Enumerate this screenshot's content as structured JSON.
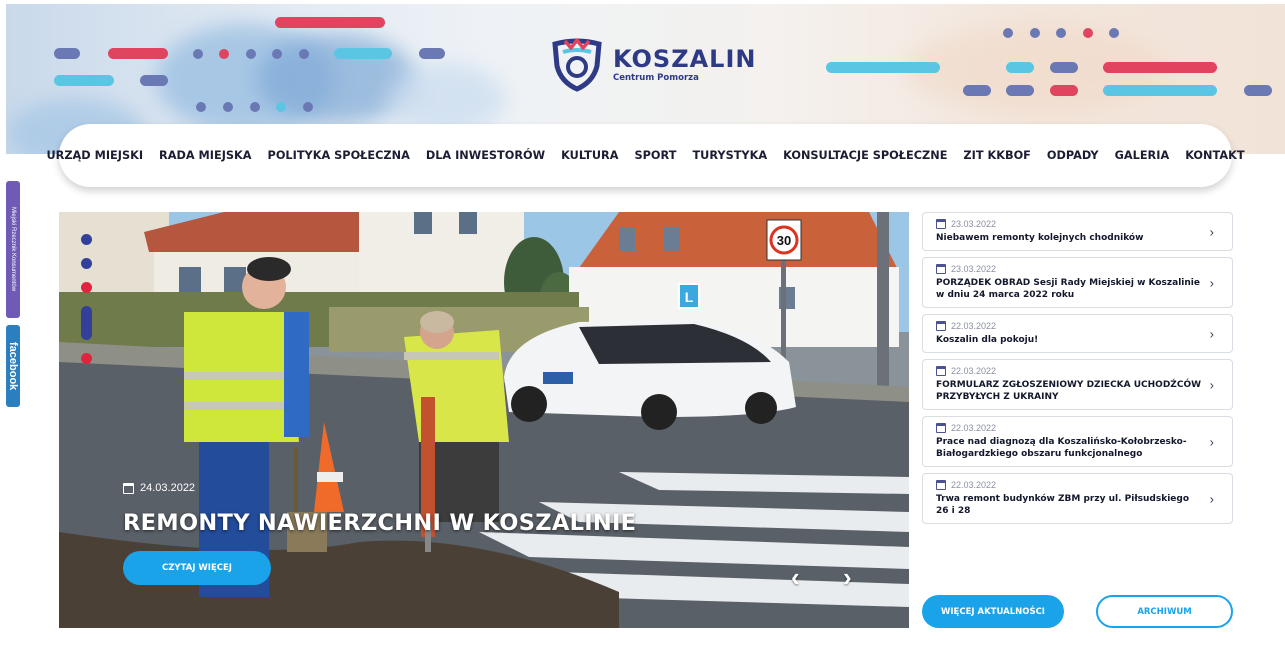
{
  "brand": {
    "name": "KOSZALIN",
    "tagline": "Centrum Pomorza",
    "colors": {
      "navy": "#2e3a86",
      "red": "#e0445f",
      "cyan": "#5bc6e3",
      "button": "#1aa3e8"
    }
  },
  "nav": {
    "items": [
      "URZĄD MIEJSKI",
      "RADA MIEJSKA",
      "POLITYKA SPOŁECZNA",
      "DLA INWESTORÓW",
      "KULTURA",
      "SPORT",
      "TURYSTYKA",
      "KONSULTACJE SPOŁECZNE",
      "ZIT KKBOF",
      "ODPADY",
      "GALERIA",
      "KONTAKT"
    ]
  },
  "side_tabs": {
    "bip": "Miejski Rzecznik Konsumentów",
    "facebook": "facebook"
  },
  "hero": {
    "date": "24.03.2022",
    "title": "REMONTY NAWIERZCHNI W KOSZALINIE",
    "button": "CZYTAJ WIĘCEJ",
    "prev_icon": "chevron-left-icon",
    "next_icon": "chevron-right-icon",
    "image_sign": "30",
    "car_sign": "L"
  },
  "news": [
    {
      "date": "23.03.2022",
      "title": "Niebawem remonty kolejnych chodników"
    },
    {
      "date": "23.03.2022",
      "title": "PORZĄDEK OBRAD Sesji Rady Miejskiej w Koszalinie w dniu 24 marca 2022 roku"
    },
    {
      "date": "22.03.2022",
      "title": "Koszalin dla pokoju!"
    },
    {
      "date": "22.03.2022",
      "title": "FORMULARZ ZGŁOSZENIOWY DZIECKA UCHODŹCÓW PRZYBYŁYCH Z UKRAINY"
    },
    {
      "date": "22.03.2022",
      "title": "Prace nad diagnozą dla Koszalińsko-Kołobrzesko-Białogardzkiego obszaru funkcjonalnego"
    },
    {
      "date": "22.03.2022",
      "title": "Trwa remont budynków ZBM przy ul. Piłsudskiego 26 i 28"
    }
  ],
  "buttons": {
    "more_news": "WIĘCEJ AKTUALNOŚCI",
    "archive": "ARCHIWUM"
  }
}
